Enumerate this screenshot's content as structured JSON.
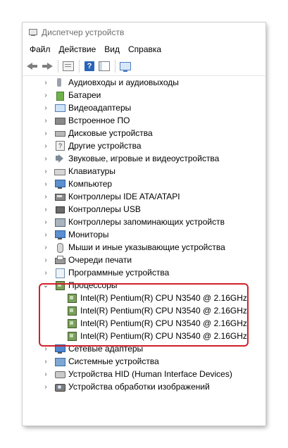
{
  "window": {
    "title": "Диспетчер устройств"
  },
  "menu": {
    "items": [
      "Файл",
      "Действие",
      "Вид",
      "Справка"
    ]
  },
  "toolbar": {
    "icons": [
      "back-arrow-icon",
      "forward-arrow-icon",
      "properties-icon",
      "help-icon",
      "show-panel-icon",
      "monitor-icon"
    ],
    "help_glyph": "?"
  },
  "tree": {
    "categories": [
      {
        "label": "Аудиовходы и аудиовыходы",
        "icon": "audio-icon"
      },
      {
        "label": "Батареи",
        "icon": "battery-icon"
      },
      {
        "label": "Видеоадаптеры",
        "icon": "display-adapter-icon"
      },
      {
        "label": "Встроенное ПО",
        "icon": "firmware-icon"
      },
      {
        "label": "Дисковые устройства",
        "icon": "disk-drive-icon"
      },
      {
        "label": "Другие устройства",
        "icon": "other-devices-icon"
      },
      {
        "label": "Звуковые, игровые и видеоустройства",
        "icon": "sound-icon"
      },
      {
        "label": "Клавиатуры",
        "icon": "keyboard-icon"
      },
      {
        "label": "Компьютер",
        "icon": "computer-icon"
      },
      {
        "label": "Контроллеры IDE ATA/ATAPI",
        "icon": "ide-controller-icon"
      },
      {
        "label": "Контроллеры USB",
        "icon": "usb-controller-icon"
      },
      {
        "label": "Контроллеры запоминающих устройств",
        "icon": "storage-controller-icon"
      },
      {
        "label": "Мониторы",
        "icon": "monitor-icon"
      },
      {
        "label": "Мыши и иные указывающие устройства",
        "icon": "mouse-icon"
      },
      {
        "label": "Очереди печати",
        "icon": "print-queue-icon"
      },
      {
        "label": "Программные устройства",
        "icon": "software-device-icon"
      }
    ],
    "processors": {
      "label": "Процессоры",
      "icon": "processor-icon",
      "children": [
        "Intel(R) Pentium(R) CPU  N3540  @ 2.16GHz",
        "Intel(R) Pentium(R) CPU  N3540  @ 2.16GHz",
        "Intel(R) Pentium(R) CPU  N3540  @ 2.16GHz",
        "Intel(R) Pentium(R) CPU  N3540  @ 2.16GHz"
      ]
    },
    "after": [
      {
        "label": "Сетевые адаптеры",
        "icon": "network-adapter-icon"
      },
      {
        "label": "Системные устройства",
        "icon": "system-device-icon"
      },
      {
        "label": "Устройства HID (Human Interface Devices)",
        "icon": "hid-icon"
      },
      {
        "label": "Устройства обработки изображений",
        "icon": "imaging-device-icon"
      }
    ],
    "collapsed_glyph": "›",
    "expanded_glyph": "⌄"
  },
  "colors": {
    "highlight": "#d2212a",
    "help_icon": "#2a64b8"
  }
}
